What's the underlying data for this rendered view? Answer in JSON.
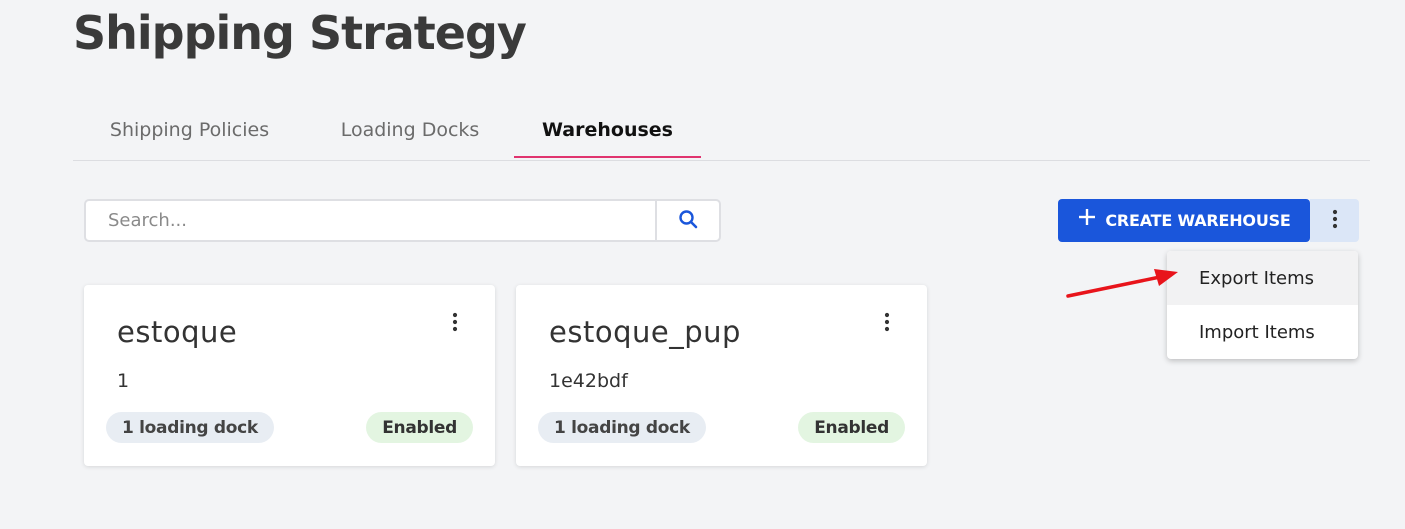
{
  "page": {
    "title": "Shipping Strategy"
  },
  "tabs": [
    {
      "label": "Shipping Policies"
    },
    {
      "label": "Loading Docks"
    },
    {
      "label": "Warehouses",
      "active": true
    }
  ],
  "search": {
    "placeholder": "Search...",
    "value": ""
  },
  "toolbar": {
    "create_label": "CREATE WAREHOUSE",
    "create_icon": "plus-icon",
    "more_icon": "kebab-icon"
  },
  "menu": {
    "items": [
      {
        "label": "Export Items",
        "highlighted": true
      },
      {
        "label": "Import Items"
      }
    ]
  },
  "warehouses": [
    {
      "name": "estoque",
      "id": "1",
      "docks": "1 loading dock",
      "status": "Enabled"
    },
    {
      "name": "estoque_pup",
      "id": "1e42bdf",
      "docks": "1 loading dock",
      "status": "Enabled"
    }
  ],
  "colors": {
    "primary": "#1a56db",
    "tab_underline": "#e0336f",
    "enabled_bg": "#e3f5e1",
    "annotation_arrow": "#e8141b"
  }
}
